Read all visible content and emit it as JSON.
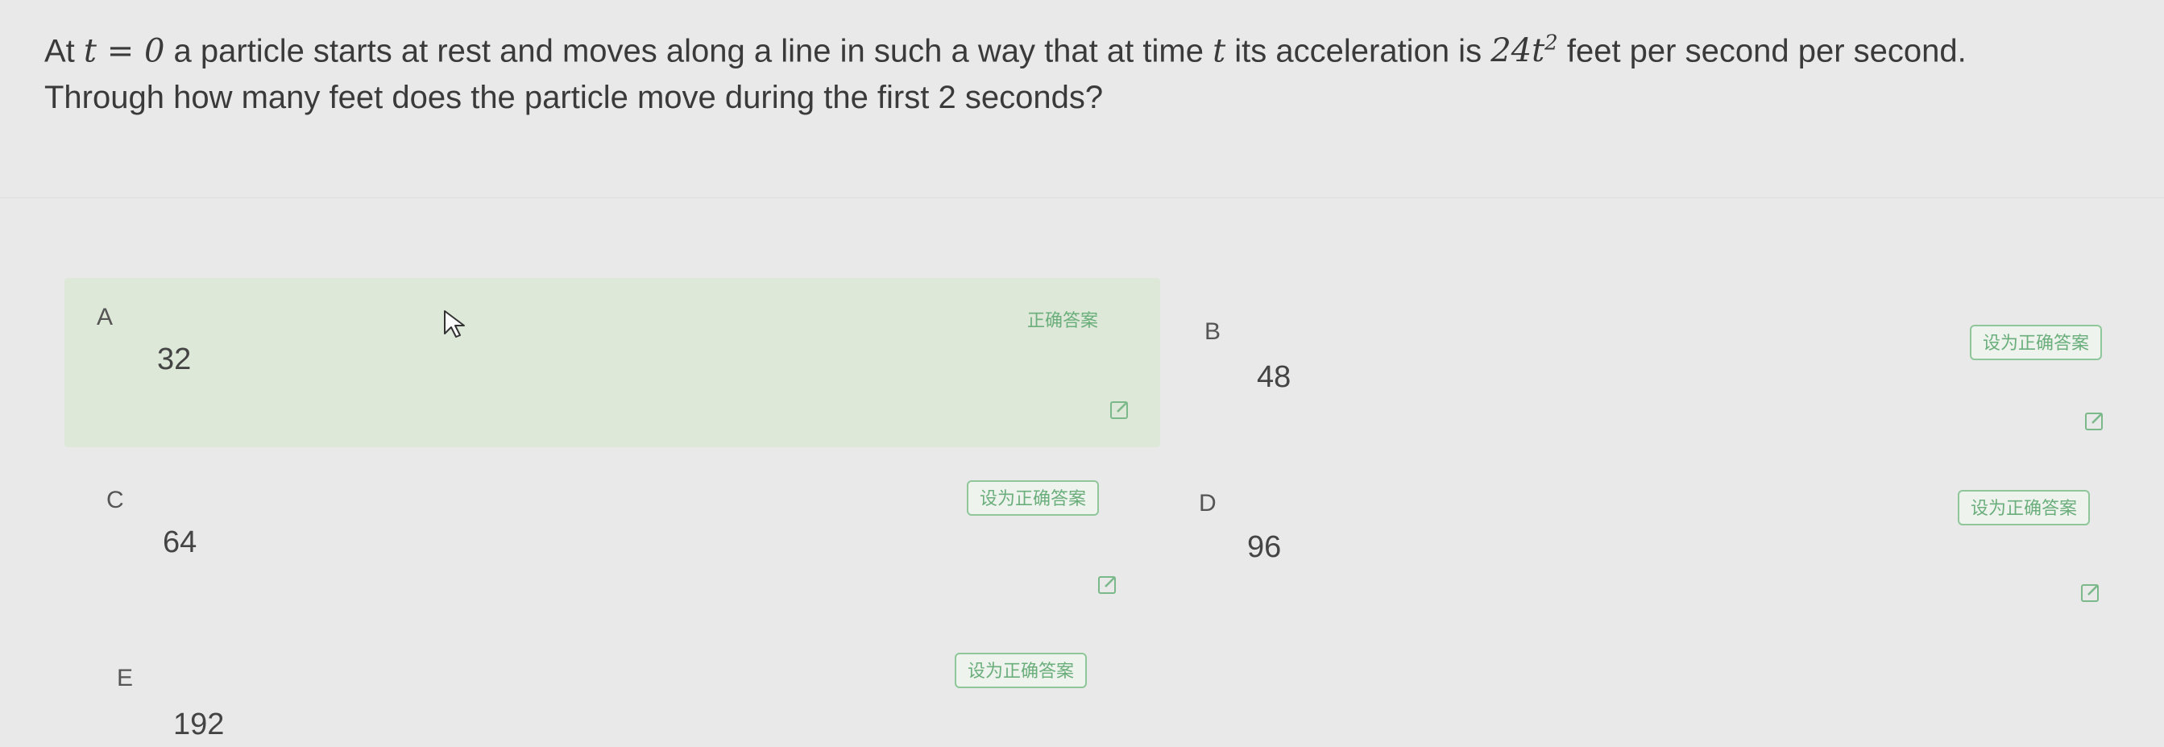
{
  "question": {
    "intro": "At",
    "t_equals_zero": "t = 0",
    "part1": "a particle starts at rest and moves along a line in such a way that at time",
    "t": "t",
    "part2": "its acceleration is",
    "accel_coeff_var": "24t",
    "accel_exp": "2",
    "part3": "feet per second per second.",
    "line2": "Through how many feet does the particle move during the first 2 seconds?"
  },
  "options": [
    {
      "letter": "A",
      "value": "32",
      "status_label": "正确答案",
      "is_correct": true
    },
    {
      "letter": "B",
      "value": "48",
      "button_label": "设为正确答案"
    },
    {
      "letter": "C",
      "value": "64",
      "button_label": "设为正确答案"
    },
    {
      "letter": "D",
      "value": "96",
      "button_label": "设为正确答案"
    },
    {
      "letter": "E",
      "value": "192",
      "button_label": "设为正确答案"
    }
  ],
  "icons": {
    "edit": "edit-icon",
    "cursor": "mouse-pointer-icon"
  },
  "colors": {
    "correct_bg": "#dde8d8",
    "accent_green": "#6aae7b",
    "page_bg": "#e9e9e9"
  }
}
